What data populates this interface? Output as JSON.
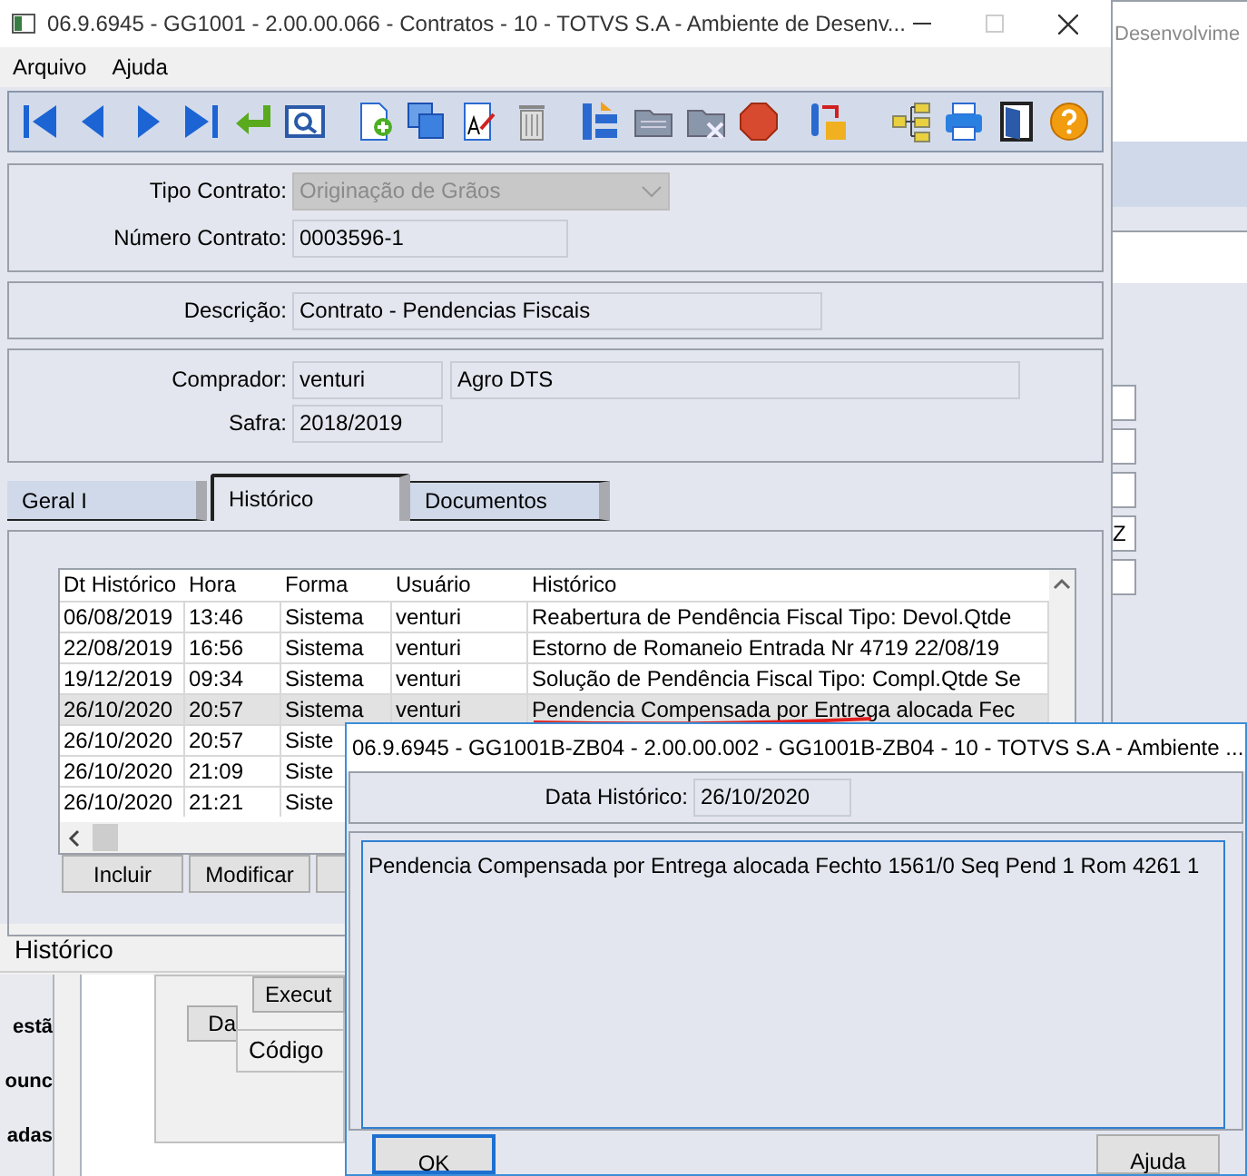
{
  "background": {
    "header_fragment": "Desenvolvime",
    "field_fragment": "Z",
    "section_title": "Histórico",
    "sidebar_fragments": [
      "estã",
      "ounc",
      "adas"
    ],
    "buttons": [
      "Execut",
      "Da"
    ],
    "field_label_fragment": "Código"
  },
  "window": {
    "title": "06.9.6945 - GG1001 - 2.00.00.066 - Contratos - 10 - TOTVS S.A - Ambiente de Desenv..."
  },
  "menu": [
    "Arquivo",
    "Ajuda"
  ],
  "form": {
    "tipo_contrato": {
      "label": "Tipo Contrato:",
      "value": "Originação de Grãos",
      "disabled": true
    },
    "numero_contrato": {
      "label": "Número Contrato:",
      "value": "0003596-1"
    },
    "descricao": {
      "label": "Descrição:",
      "value": "Contrato - Pendencias Fiscais"
    },
    "comprador": {
      "label": "Comprador:",
      "value": "venturi",
      "name": "Agro DTS"
    },
    "safra": {
      "label": "Safra:",
      "value": "2018/2019"
    }
  },
  "tabs": [
    {
      "label": "Geral I",
      "selected": false
    },
    {
      "label": "Histórico",
      "selected": true
    },
    {
      "label": "Documentos",
      "selected": false
    }
  ],
  "table": {
    "columns": [
      "Dt Histórico",
      "Hora",
      "Forma",
      "Usuário",
      "Histórico"
    ],
    "rows": [
      {
        "cells": [
          "06/08/2019",
          "13:46",
          "Sistema",
          "venturi",
          "Reabertura de Pendência Fiscal Tipo: Devol.Qtde"
        ],
        "selected": false,
        "marked": false
      },
      {
        "cells": [
          "22/08/2019",
          "16:56",
          "Sistema",
          "venturi",
          "Estorno de Romaneio Entrada Nr 4719 22/08/19"
        ],
        "selected": false,
        "marked": false
      },
      {
        "cells": [
          "19/12/2019",
          "09:34",
          "Sistema",
          "venturi",
          "Solução de Pendência Fiscal Tipo: Compl.Qtde Se"
        ],
        "selected": false,
        "marked": false
      },
      {
        "cells": [
          "26/10/2020",
          "20:57",
          "Sistema",
          "venturi",
          "Pendencia Compensada por Entrega alocada Fec"
        ],
        "selected": true,
        "marked": true
      },
      {
        "cells": [
          "26/10/2020",
          "20:57",
          "Siste"
        ],
        "selected": false,
        "marked": false
      },
      {
        "cells": [
          "26/10/2020",
          "21:09",
          "Siste"
        ],
        "selected": false,
        "marked": false
      },
      {
        "cells": [
          "26/10/2020",
          "21:21",
          "Siste"
        ],
        "selected": false,
        "marked": false
      }
    ]
  },
  "buttons": [
    "Incluir",
    "Modificar"
  ],
  "dialog": {
    "title": "06.9.6945 - GG1001B-ZB04 - 2.00.00.002 - GG1001B-ZB04 - 10 - TOTVS S.A - Ambiente ...",
    "date_label": "Data Histórico:",
    "date_value": "26/10/2020",
    "text": "Pendencia Compensada por Entrega alocada Fechto 1561/0 Seq Pend 1 Rom 4261 1",
    "buttons": [
      {
        "label": "OK",
        "focused": true
      },
      {
        "label": "Ajuda",
        "focused": false
      }
    ]
  }
}
